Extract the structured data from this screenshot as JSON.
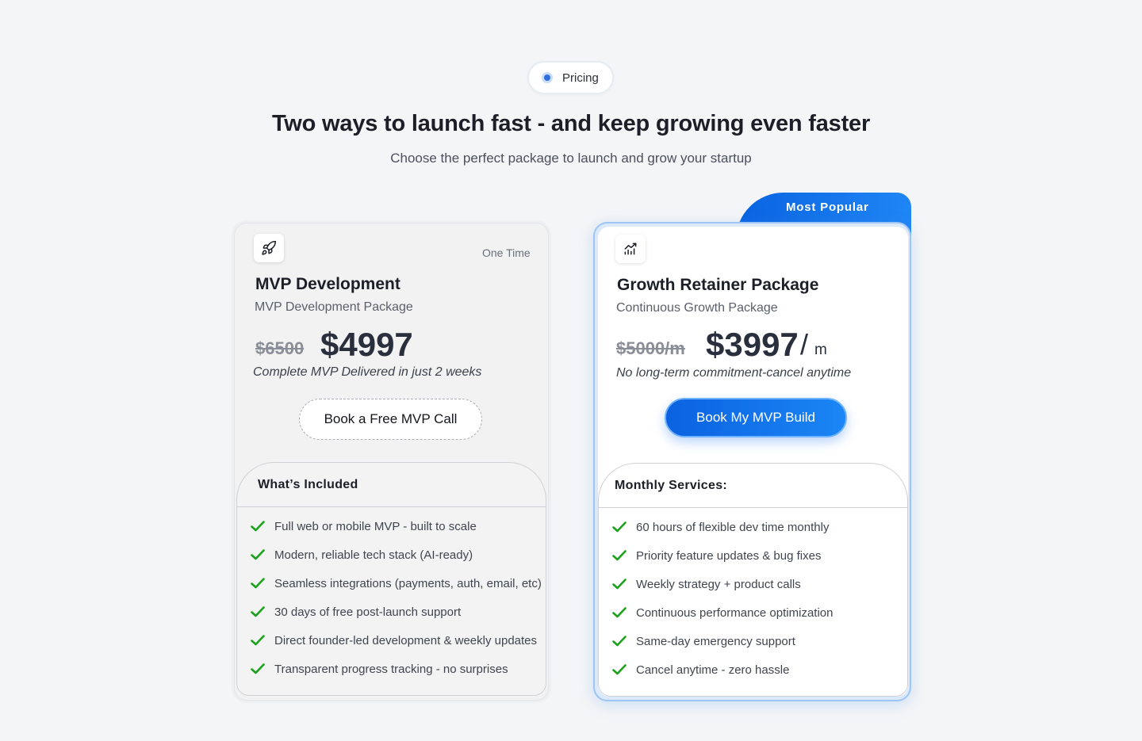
{
  "badge": {
    "label": "Pricing"
  },
  "header": {
    "title": "Two ways to launch fast - and keep growing even faster",
    "subtitle": "Choose the perfect package to launch and grow your startup"
  },
  "colors": {
    "accent": "#1877f2",
    "check": "#1aa31a"
  },
  "plans": [
    {
      "icon": "rocket-icon",
      "kind": "One Time",
      "title": "MVP Development",
      "subtitle": "MVP Development Package",
      "old_price": "$6500",
      "price": "$4997",
      "note": "Complete MVP Delivered in just 2 weeks",
      "cta": "Book a Free MVP Call",
      "features_title": "What’s Included",
      "features": [
        "Full web or mobile MVP - built to scale",
        "Modern, reliable tech stack (AI-ready)",
        "Seamless integrations (payments, auth, email, etc)",
        "30 days of free post-launch support",
        "Direct founder-led development & weekly updates",
        "Transparent progress tracking - no surprises"
      ]
    },
    {
      "icon": "growth-chart-icon",
      "ribbon": "Most Popular",
      "title": "Growth Retainer Package",
      "subtitle": "Continuous Growth Package",
      "old_price": "$5000/m",
      "price": "$3997",
      "per": "/",
      "per_unit": "m",
      "note": "No long-term commitment-cancel anytime",
      "cta": "Book My MVP Build",
      "features_title": "Monthly Services:",
      "features": [
        "60 hours of flexible dev time monthly",
        "Priority feature updates & bug fixes",
        "Weekly strategy + product calls",
        "Continuous performance optimization",
        "Same-day emergency support",
        "Cancel anytime - zero hassle"
      ]
    }
  ]
}
